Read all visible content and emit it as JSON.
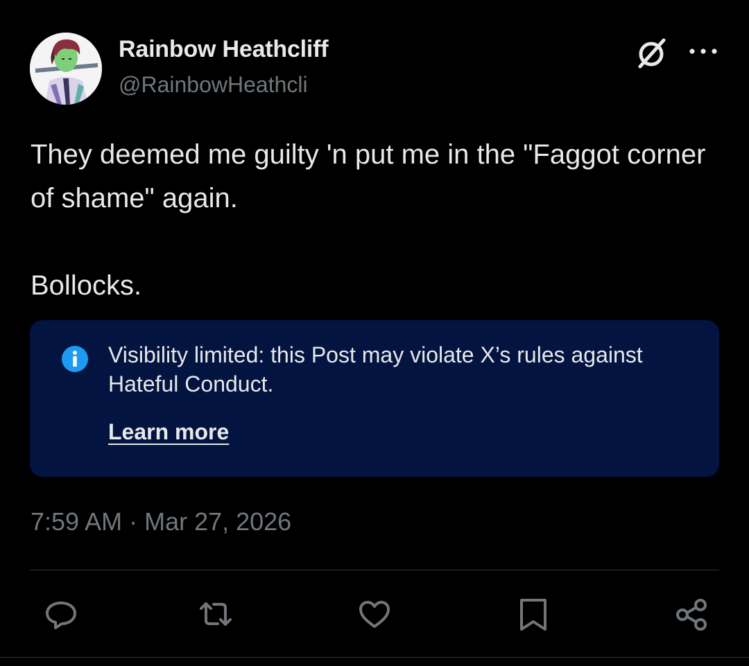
{
  "author": {
    "display_name": "Rainbow Heathcliff",
    "handle": "@RainbowHeathcli"
  },
  "icons": {
    "avatar": "avatar",
    "grok": "grok-icon",
    "more": "more-icon",
    "info": "info-icon",
    "reply": "reply-icon",
    "repost": "repost-icon",
    "like": "like-icon",
    "bookmark": "bookmark-icon",
    "share": "share-icon"
  },
  "post": {
    "text": "They deemed me guilty 'n put me in the \"Faggot corner of shame\" again.\n\nBollocks."
  },
  "notice": {
    "message": "Visibility limited: this Post may violate X’s rules against Hateful Conduct.",
    "link_label": "Learn more"
  },
  "timestamp": "7:59 AM · Mar 27, 2026",
  "colors": {
    "background": "#000000",
    "text_primary": "#e7e9ea",
    "text_secondary": "#71767b",
    "notice_background": "#031440",
    "info_blue": "#1d9bf0",
    "divider": "#2f3336"
  }
}
